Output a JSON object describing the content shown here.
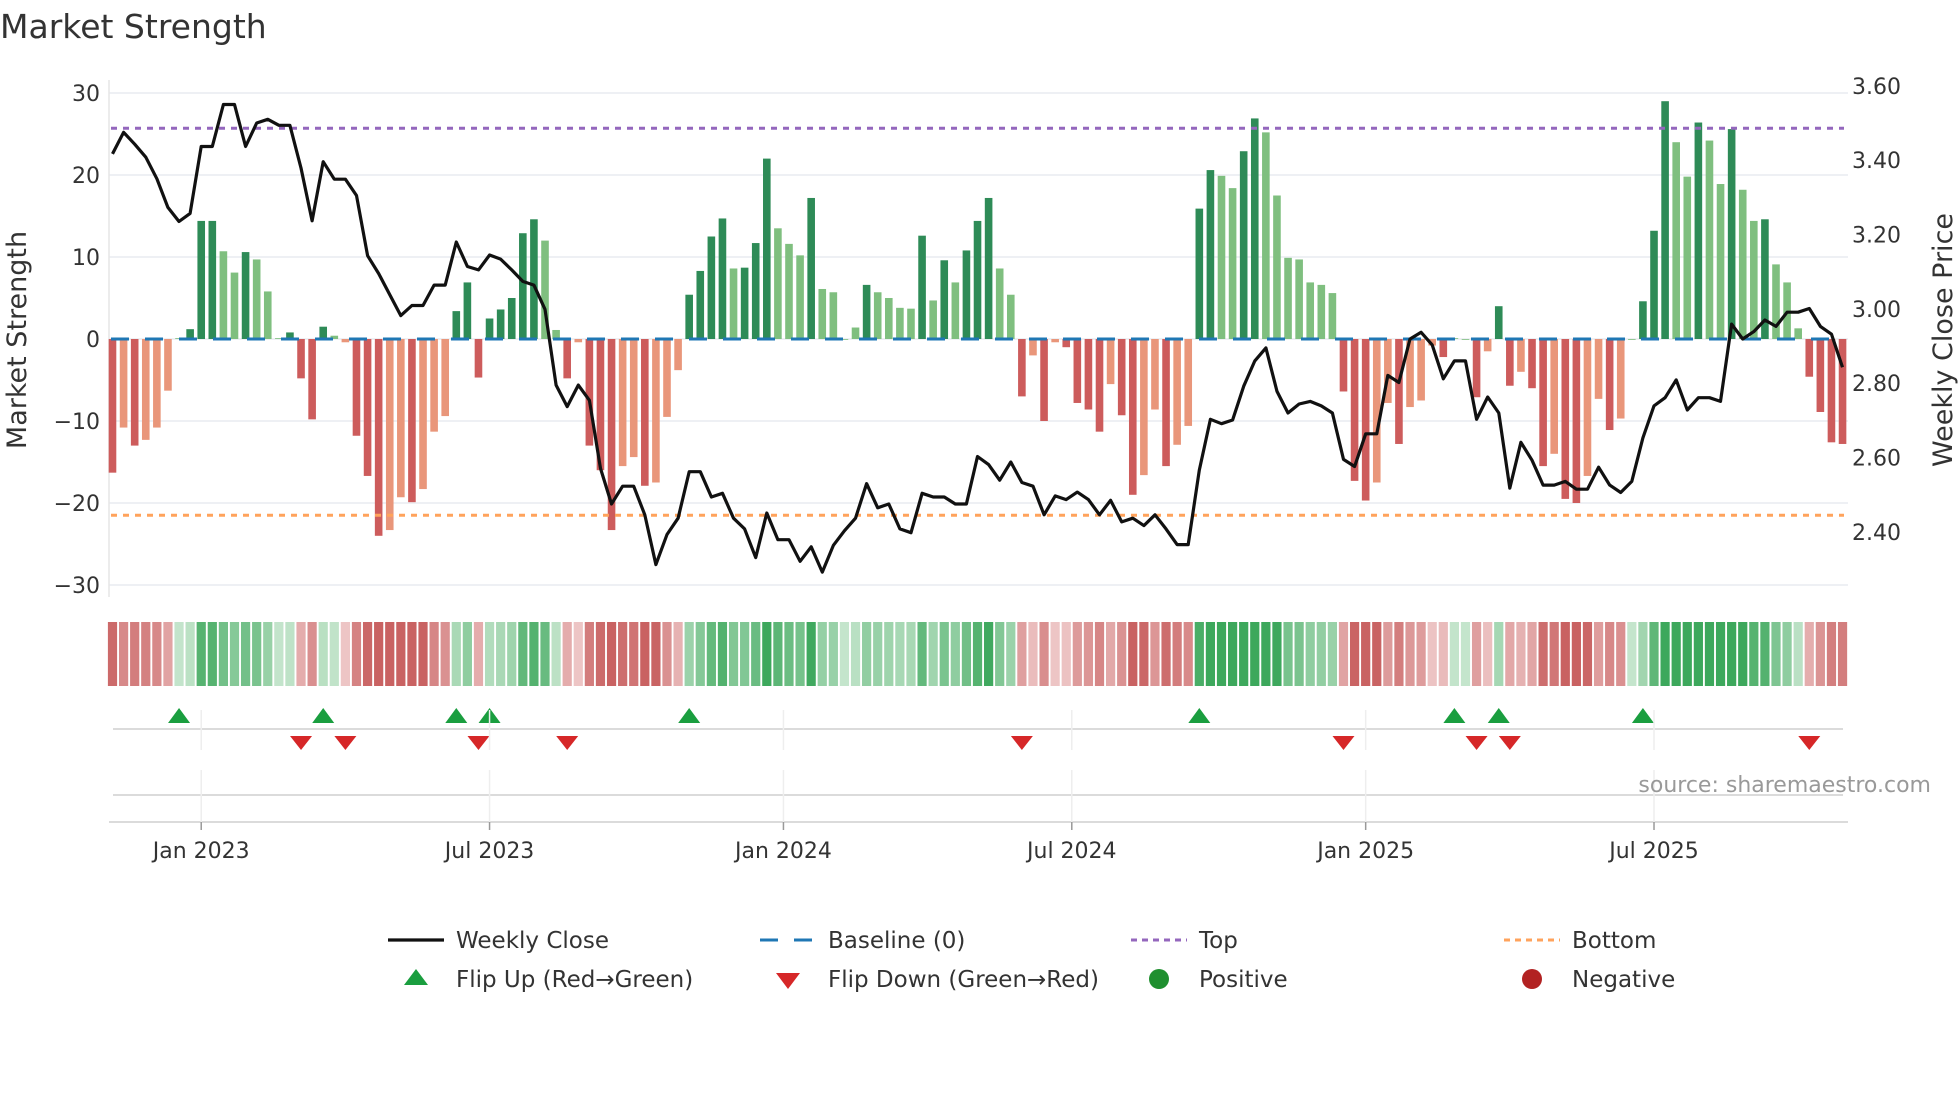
{
  "chart_data": {
    "type": "bar",
    "title": "Market Strength",
    "ylabel": "Market Strength",
    "y2label": "Weekly Close Price",
    "ylim": [
      -30,
      30
    ],
    "y2lim": [
      2.4,
      3.6
    ],
    "yticks": [
      "30",
      "20",
      "10",
      "0",
      "−10",
      "−20",
      "−30"
    ],
    "ytick_values": [
      30,
      20,
      10,
      0,
      -10,
      -20,
      -30
    ],
    "y2ticks": [
      "3.60",
      "3.40",
      "3.20",
      "3.00",
      "2.80",
      "2.60",
      "2.40"
    ],
    "y2tick_values": [
      3.6,
      3.4,
      3.2,
      3.0,
      2.8,
      2.6,
      2.4
    ],
    "xticks": [
      "Jan 2023",
      "Jul 2023",
      "Jan 2024",
      "Jul 2024",
      "Jan 2025",
      "Jul 2025"
    ],
    "xtick_week_index": [
      8,
      34,
      60.5,
      86.5,
      113,
      139
    ],
    "frequency": "weekly",
    "top_level": 25.7,
    "bottom_level": -21.5,
    "strength": [
      -16.3,
      -10.8,
      -13,
      -12.3,
      -10.8,
      -6.3,
      0.1,
      1.2,
      14.4,
      14.4,
      10.7,
      8.1,
      10.6,
      9.7,
      5.8,
      0.1,
      0.8,
      -4.8,
      -9.8,
      1.5,
      0.4,
      -0.4,
      -11.8,
      -16.7,
      -24,
      -23.3,
      -19.3,
      -19.9,
      -18.3,
      -11.3,
      -9.4,
      3.4,
      6.9,
      -4.7,
      2.5,
      3.6,
      5,
      12.9,
      14.6,
      12,
      1.1,
      -4.8,
      -0.4,
      -13,
      -16,
      -23.3,
      -15.5,
      -14.4,
      -17.9,
      -17.5,
      -9.5,
      -3.8,
      5.4,
      8.3,
      12.5,
      14.7,
      8.6,
      8.7,
      11.7,
      22,
      13.5,
      11.6,
      10.2,
      17.2,
      6.1,
      5.7,
      0,
      1.4,
      6.6,
      5.7,
      5,
      3.8,
      3.7,
      12.6,
      4.7,
      9.6,
      6.9,
      10.8,
      14.4,
      17.2,
      8.6,
      5.4,
      -7,
      -2,
      -10,
      -0.4,
      -1,
      -7.8,
      -8.6,
      -11.3,
      -5.5,
      -9.3,
      -19,
      -16.6,
      -8.6,
      -15.5,
      -12.9,
      -10.6,
      15.9,
      20.6,
      19.9,
      18.4,
      22.9,
      26.9,
      25.2,
      17.5,
      9.9,
      9.7,
      6.9,
      6.6,
      5.6,
      -6.4,
      -17.3,
      -19.7,
      -17.5,
      -7.8,
      -12.8,
      -8.3,
      -7.5,
      -0.8,
      -2.2,
      0.1,
      0,
      -7.1,
      -1.5,
      4,
      -5.7,
      -4,
      -6,
      -15.5,
      -14,
      -19.5,
      -20,
      -16.7,
      -7.3,
      -11.1,
      -9.7,
      0,
      4.6,
      13.2,
      29,
      24,
      19.8,
      26.4,
      24.2,
      18.9,
      25.6,
      18.2,
      14.4,
      14.6,
      9.1,
      6.9,
      1.3,
      -4.6,
      -8.9,
      -12.6,
      -12.8
    ],
    "shade": "DLDLLLLDDDLLDLLLDDDDLLDDDLLDLLLDDDDDDDDLLDLDDDLLDLLLDDDDLDDDLLLDLLLLDLLLLDLDLDDDLLDLDLDDDDLDDLLDLLDDLLDDLLLLLLLDDDLLDLLLDLLDLDDLDDLDDLLDLLDDDLLDLLDLLDLLLDDDD",
    "weekly_close": [
      3.417,
      3.475,
      3.443,
      3.408,
      3.35,
      3.273,
      3.235,
      3.257,
      3.437,
      3.437,
      3.55,
      3.55,
      3.437,
      3.5,
      3.51,
      3.494,
      3.494,
      3.379,
      3.237,
      3.396,
      3.349,
      3.349,
      3.305,
      3.143,
      3.095,
      3.038,
      2.982,
      3.009,
      3.009,
      3.064,
      3.064,
      3.18,
      3.114,
      3.105,
      3.145,
      3.134,
      3.105,
      3.074,
      3.064,
      2.999,
      2.795,
      2.737,
      2.795,
      2.754,
      2.571,
      2.475,
      2.523,
      2.523,
      2.446,
      2.312,
      2.393,
      2.437,
      2.562,
      2.562,
      2.494,
      2.504,
      2.437,
      2.408,
      2.331,
      2.451,
      2.379,
      2.379,
      2.321,
      2.36,
      2.292,
      2.364,
      2.403,
      2.437,
      2.53,
      2.465,
      2.475,
      2.408,
      2.398,
      2.504,
      2.494,
      2.494,
      2.475,
      2.475,
      2.603,
      2.581,
      2.539,
      2.588,
      2.533,
      2.523,
      2.446,
      2.497,
      2.487,
      2.507,
      2.487,
      2.446,
      2.485,
      2.427,
      2.437,
      2.417,
      2.446,
      2.408,
      2.366,
      2.366,
      2.566,
      2.703,
      2.691,
      2.701,
      2.792,
      2.86,
      2.895,
      2.778,
      2.72,
      2.744,
      2.751,
      2.739,
      2.72,
      2.595,
      2.576,
      2.664,
      2.664,
      2.821,
      2.802,
      2.919,
      2.937,
      2.903,
      2.812,
      2.86,
      2.86,
      2.703,
      2.763,
      2.72,
      2.518,
      2.641,
      2.593,
      2.526,
      2.526,
      2.536,
      2.515,
      2.515,
      2.574,
      2.526,
      2.506,
      2.536,
      2.653,
      2.739,
      2.761,
      2.809,
      2.728,
      2.761,
      2.761,
      2.751,
      2.959,
      2.919,
      2.939,
      2.97,
      2.953,
      2.991,
      2.991,
      3.001,
      2.953,
      2.932,
      2.843
    ],
    "flip_up_weeks": [
      7,
      20,
      32,
      35,
      53,
      99,
      122,
      126,
      139
    ],
    "flip_down_weeks": [
      18,
      22,
      34,
      42,
      83,
      112,
      124,
      127,
      154
    ],
    "legend_position": "bottom-center",
    "legend": [
      {
        "key": "weekly_close",
        "label": "Weekly Close"
      },
      {
        "key": "baseline",
        "label": "Baseline (0)"
      },
      {
        "key": "top",
        "label": "Top"
      },
      {
        "key": "bottom",
        "label": "Bottom"
      },
      {
        "key": "flip_up",
        "label": "Flip Up (Red→Green)"
      },
      {
        "key": "flip_down",
        "label": "Flip Down (Green→Red)"
      },
      {
        "key": "positive",
        "label": "Positive"
      },
      {
        "key": "negative",
        "label": "Negative"
      }
    ],
    "source": "source: sharemaestro.com",
    "colors": {
      "pos_strong": "#2e8b57",
      "pos_weak": "#7fbf7f",
      "neg_strong": "#cd5c5c",
      "neg_weak": "#e9967a",
      "line": "#111111",
      "baseline": "#1f77b4",
      "top": "#9467bd",
      "bottom": "#ffa35c",
      "flip_up": "#1a9e3f",
      "flip_down": "#d62728",
      "positive": "#1f8f2f",
      "negative": "#b22222"
    }
  }
}
